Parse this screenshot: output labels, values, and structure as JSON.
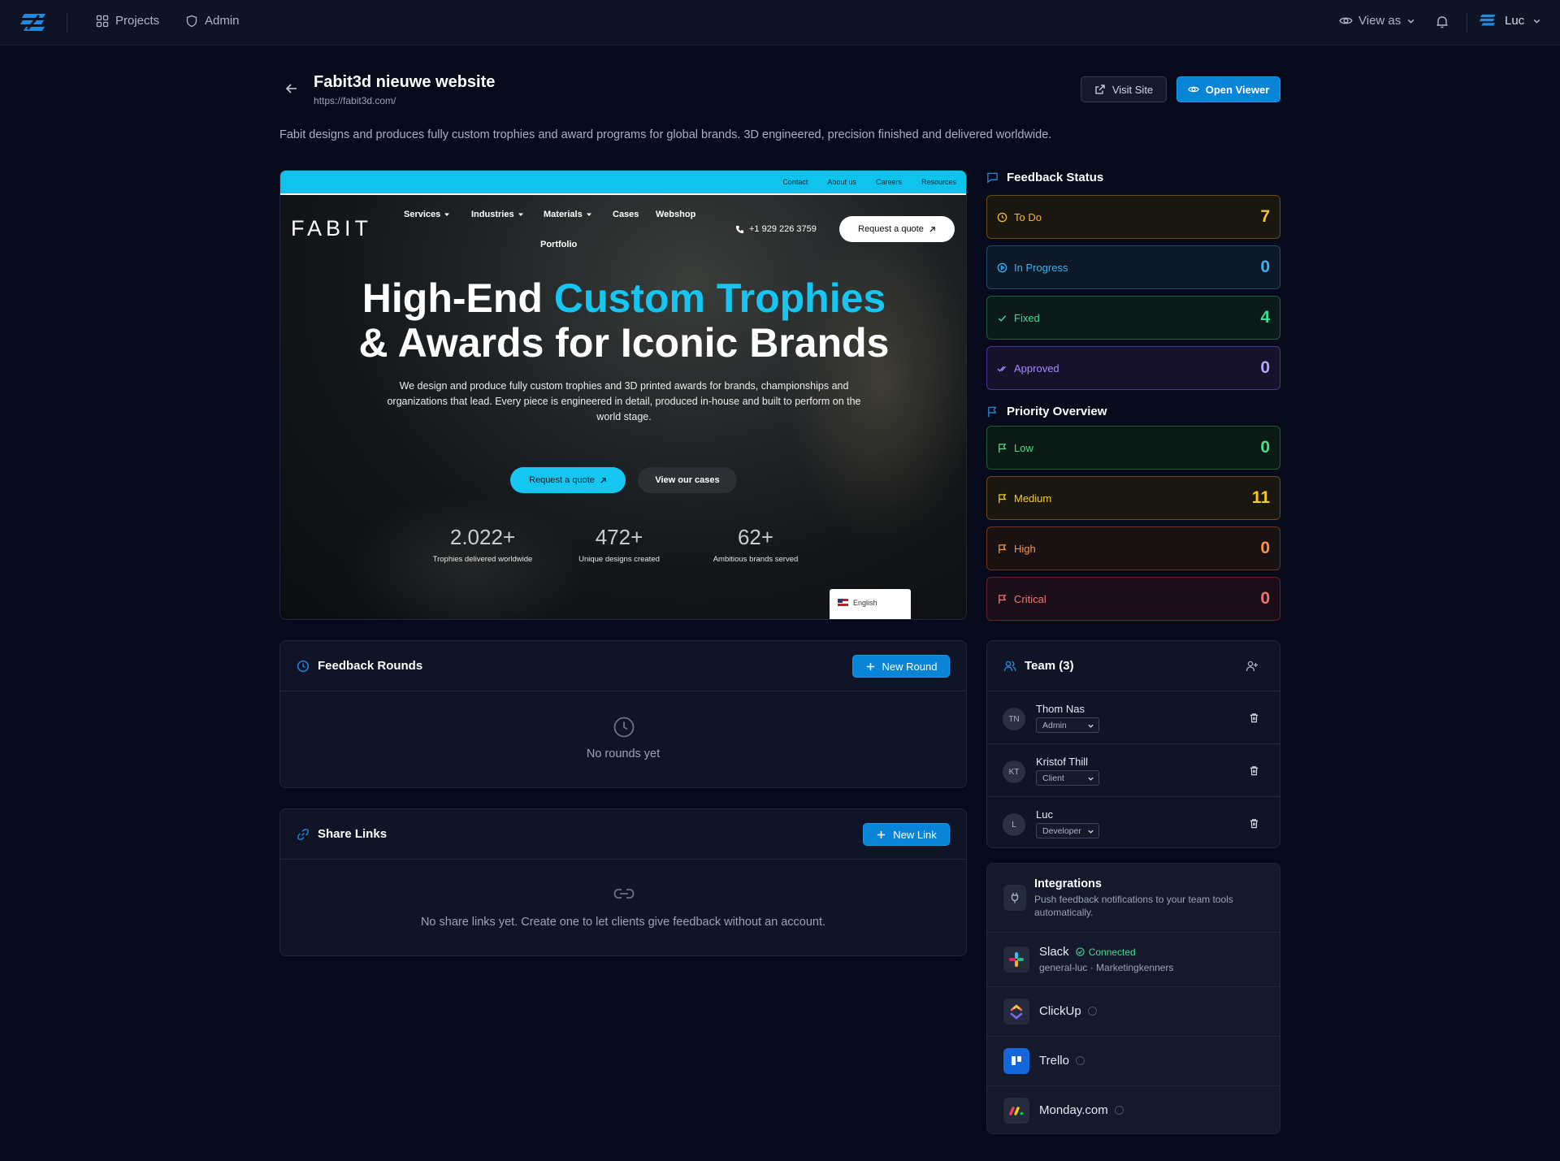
{
  "topbar": {
    "nav": [
      {
        "label": "Projects",
        "icon": "grid-icon"
      },
      {
        "label": "Admin",
        "icon": "shield-icon"
      }
    ],
    "view_as": "View as",
    "user_name": "Luc"
  },
  "project": {
    "title": "Fabit3d nieuwe website",
    "url": "https://fabit3d.com/",
    "description": "Fabit designs and produces fully custom trophies and award programs for global brands. 3D engineered, precision finished and delivered worldwide.",
    "visit_label": "Visit Site",
    "open_label": "Open Viewer"
  },
  "preview": {
    "top_links": [
      "Contact",
      "About us",
      "Careers",
      "Resources"
    ],
    "logo": "FABIT",
    "menu": [
      {
        "label": "Services",
        "dropdown": true
      },
      {
        "label": "Industries",
        "dropdown": true
      },
      {
        "label": "Materials",
        "dropdown": true
      },
      {
        "label": "Cases",
        "dropdown": false
      },
      {
        "label": "Webshop",
        "dropdown": false
      },
      {
        "label": "Portfolio",
        "dropdown": false
      }
    ],
    "phone": "+1 929 226 3759",
    "request_label": "Request a quote",
    "headline_part1": "High-End ",
    "headline_accent": "Custom Trophies",
    "headline_part2": "& Awards for Iconic Brands",
    "subtitle": "We design and produce fully custom trophies and 3D printed awards for brands, championships and organizations that lead. Every piece is engineered in detail, produced in-house and built to perform on the world stage.",
    "cta_primary": "Request a quote",
    "cta_secondary": "View our cases",
    "stats": [
      {
        "value": "2.022+",
        "label": "Trophies delivered worldwide"
      },
      {
        "value": "472+",
        "label": "Unique designs created"
      },
      {
        "value": "62+",
        "label": "Ambitious brands served"
      }
    ],
    "language": "English",
    "accent_color": "#14c6f0"
  },
  "feedback_rounds": {
    "title": "Feedback Rounds",
    "button": "New Round",
    "empty": "No rounds yet"
  },
  "share_links": {
    "title": "Share Links",
    "button": "New Link",
    "empty": "No share links yet. Create one to let clients give feedback without an account."
  },
  "feedback_status": {
    "title": "Feedback Status",
    "items": [
      {
        "label": "To Do",
        "count": "7",
        "color": "#f5b82e",
        "icon": "clock-icon"
      },
      {
        "label": "In Progress",
        "count": "0",
        "color": "#3ab0f5",
        "icon": "play-circle-icon"
      },
      {
        "label": "Fixed",
        "count": "4",
        "color": "#3ddc97",
        "icon": "check-icon"
      },
      {
        "label": "Approved",
        "count": "0",
        "color": "#a78bfa",
        "icon": "double-check-icon"
      }
    ]
  },
  "priority_overview": {
    "title": "Priority Overview",
    "items": [
      {
        "label": "Low",
        "count": "0",
        "color": "#4ade80"
      },
      {
        "label": "Medium",
        "count": "11",
        "color": "#facc15"
      },
      {
        "label": "High",
        "count": "0",
        "color": "#fb923c"
      },
      {
        "label": "Critical",
        "count": "0",
        "color": "#f87171"
      }
    ]
  },
  "team": {
    "title": "Team (3)",
    "members": [
      {
        "initials": "TN",
        "name": "Thom Nas",
        "role": "Admin"
      },
      {
        "initials": "KT",
        "name": "Kristof Thill",
        "role": "Client"
      },
      {
        "initials": "L",
        "name": "Luc",
        "role": "Developer"
      }
    ]
  },
  "integrations": {
    "title": "Integrations",
    "subtitle": "Push feedback notifications to your team tools automatically.",
    "items": [
      {
        "name": "Slack",
        "status": "Connected",
        "detail": "general-luc · Marketingkenners",
        "icon": "slack-icon"
      },
      {
        "name": "ClickUp",
        "status": "",
        "detail": "",
        "icon": "clickup-icon"
      },
      {
        "name": "Trello",
        "status": "",
        "detail": "",
        "icon": "trello-icon"
      },
      {
        "name": "Monday.com",
        "status": "",
        "detail": "",
        "icon": "monday-icon"
      }
    ]
  }
}
